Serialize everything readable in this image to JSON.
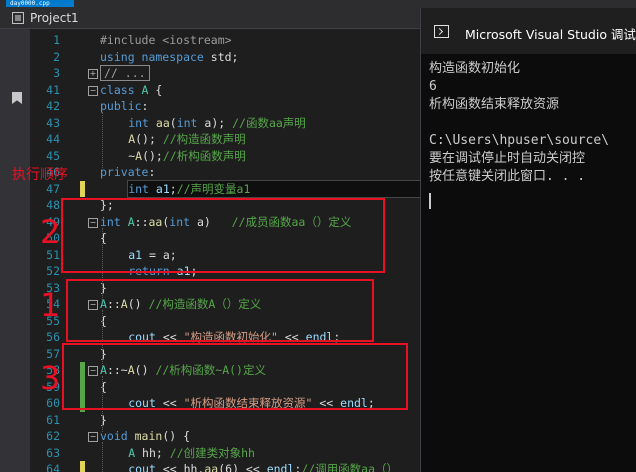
{
  "window": {
    "tab_fragment": "day0000.cpp",
    "project_label": "Project1"
  },
  "editor": {
    "lines": [
      {
        "n": "1",
        "tokens": [
          {
            "t": "pp",
            "v": "#include <iostream>"
          }
        ]
      },
      {
        "n": "2",
        "tokens": [
          {
            "t": "kw",
            "v": "using namespace "
          },
          {
            "t": "pl",
            "v": "std;"
          }
        ]
      },
      {
        "n": "3",
        "fold": "+",
        "collapsed": "// ..."
      },
      {
        "n": "41",
        "fold": "-",
        "tokens": [
          {
            "t": "kw",
            "v": "class "
          },
          {
            "t": "ty",
            "v": "A"
          },
          {
            "t": "pl",
            "v": " {"
          }
        ]
      },
      {
        "n": "42",
        "tokens": [
          {
            "t": "kw",
            "v": "public"
          },
          {
            "t": "pl",
            "v": ":"
          }
        ]
      },
      {
        "n": "43",
        "indent": 2,
        "tokens": [
          {
            "t": "kw",
            "v": "int "
          },
          {
            "t": "fn",
            "v": "aa"
          },
          {
            "t": "pl",
            "v": "("
          },
          {
            "t": "kw",
            "v": "int "
          },
          {
            "t": "pl",
            "v": "a); "
          },
          {
            "t": "cm",
            "v": "//函数aa声明"
          }
        ]
      },
      {
        "n": "44",
        "indent": 2,
        "tokens": [
          {
            "t": "fn",
            "v": "A"
          },
          {
            "t": "pl",
            "v": "(); "
          },
          {
            "t": "cm",
            "v": "//构造函数声明"
          }
        ]
      },
      {
        "n": "45",
        "indent": 2,
        "tokens": [
          {
            "t": "pl",
            "v": "~"
          },
          {
            "t": "fn",
            "v": "A"
          },
          {
            "t": "pl",
            "v": "();"
          },
          {
            "t": "cm",
            "v": "//析构函数声明"
          }
        ]
      },
      {
        "n": "46",
        "tokens": [
          {
            "t": "kw",
            "v": "private"
          },
          {
            "t": "pl",
            "v": ":"
          }
        ]
      },
      {
        "n": "47",
        "indent": 2,
        "highlight": true,
        "mark": "yellow",
        "tokens": [
          {
            "t": "kw",
            "v": "int "
          },
          {
            "t": "var",
            "v": "a1"
          },
          {
            "t": "pl",
            "v": ";"
          },
          {
            "t": "cm",
            "v": "//声明变量a1"
          }
        ]
      },
      {
        "n": "48",
        "tokens": [
          {
            "t": "pl",
            "v": "};"
          }
        ]
      },
      {
        "n": "49",
        "fold": "-",
        "tokens": [
          {
            "t": "kw",
            "v": "int "
          },
          {
            "t": "ty",
            "v": "A"
          },
          {
            "t": "pl",
            "v": "::"
          },
          {
            "t": "fn",
            "v": "aa"
          },
          {
            "t": "pl",
            "v": "("
          },
          {
            "t": "kw",
            "v": "int "
          },
          {
            "t": "pl",
            "v": "a)   "
          },
          {
            "t": "cm",
            "v": "//成员函数aa（）定义"
          }
        ]
      },
      {
        "n": "50",
        "tokens": [
          {
            "t": "pl",
            "v": "{"
          }
        ]
      },
      {
        "n": "51",
        "indent": 2,
        "tokens": [
          {
            "t": "var",
            "v": "a1"
          },
          {
            "t": "pl",
            "v": " = a;"
          }
        ]
      },
      {
        "n": "52",
        "indent": 2,
        "tokens": [
          {
            "t": "kw",
            "v": "return "
          },
          {
            "t": "var",
            "v": "a1"
          },
          {
            "t": "pl",
            "v": ";"
          }
        ]
      },
      {
        "n": "53",
        "tokens": [
          {
            "t": "pl",
            "v": "}"
          }
        ]
      },
      {
        "n": "54",
        "fold": "-",
        "tokens": [
          {
            "t": "ty",
            "v": "A"
          },
          {
            "t": "pl",
            "v": "::"
          },
          {
            "t": "fn",
            "v": "A"
          },
          {
            "t": "pl",
            "v": "() "
          },
          {
            "t": "cm",
            "v": "//构造函数A（）定义"
          }
        ]
      },
      {
        "n": "55",
        "tokens": [
          {
            "t": "pl",
            "v": "{"
          }
        ]
      },
      {
        "n": "56",
        "indent": 2,
        "tokens": [
          {
            "t": "var",
            "v": "cout"
          },
          {
            "t": "pl",
            "v": " << "
          },
          {
            "t": "str",
            "v": "\"构造函数初始化\""
          },
          {
            "t": "pl",
            "v": " << "
          },
          {
            "t": "var",
            "v": "endl"
          },
          {
            "t": "pl",
            "v": ";"
          }
        ]
      },
      {
        "n": "57",
        "tokens": [
          {
            "t": "pl",
            "v": "}"
          }
        ]
      },
      {
        "n": "58",
        "fold": "-",
        "mark": "green",
        "tokens": [
          {
            "t": "ty",
            "v": "A"
          },
          {
            "t": "pl",
            "v": "::~"
          },
          {
            "t": "fn",
            "v": "A"
          },
          {
            "t": "pl",
            "v": "() "
          },
          {
            "t": "cm",
            "v": "//析构函数~A()定义"
          }
        ]
      },
      {
        "n": "59",
        "mark": "green",
        "tokens": [
          {
            "t": "pl",
            "v": "{"
          }
        ]
      },
      {
        "n": "60",
        "indent": 2,
        "mark": "green",
        "tokens": [
          {
            "t": "var",
            "v": "cout"
          },
          {
            "t": "pl",
            "v": " << "
          },
          {
            "t": "str",
            "v": "\"析构函数结束释放资源\""
          },
          {
            "t": "pl",
            "v": " << "
          },
          {
            "t": "var",
            "v": "endl"
          },
          {
            "t": "pl",
            "v": ";"
          }
        ]
      },
      {
        "n": "61",
        "tokens": [
          {
            "t": "pl",
            "v": "}"
          }
        ]
      },
      {
        "n": "62",
        "fold": "-",
        "tokens": [
          {
            "t": "kw",
            "v": "void "
          },
          {
            "t": "fn",
            "v": "main"
          },
          {
            "t": "pl",
            "v": "() {"
          }
        ]
      },
      {
        "n": "63",
        "indent": 2,
        "tokens": [
          {
            "t": "ty",
            "v": "A"
          },
          {
            "t": "pl",
            "v": " hh; "
          },
          {
            "t": "cm",
            "v": "//创建类对象hh"
          }
        ]
      },
      {
        "n": "64",
        "indent": 2,
        "mark": "yellow",
        "tokens": [
          {
            "t": "var",
            "v": "cout"
          },
          {
            "t": "pl",
            "v": " << hh."
          },
          {
            "t": "fn",
            "v": "aa"
          },
          {
            "t": "pl",
            "v": "(6) << "
          },
          {
            "t": "var",
            "v": "endl"
          },
          {
            "t": "pl",
            "v": ";"
          },
          {
            "t": "cm",
            "v": "//调用函数aa（）"
          }
        ]
      },
      {
        "n": "65",
        "tokens": [
          {
            "t": "pl",
            "v": "}"
          }
        ]
      }
    ]
  },
  "annotations": {
    "order_label": "执行顺序",
    "num1": "1",
    "num2": "2",
    "num3": "3"
  },
  "console": {
    "title": "Microsoft Visual Studio 调试控",
    "lines": [
      "构造函数初始化",
      "6",
      "析构函数结束释放资源",
      "",
      "C:\\Users\\hpuser\\source\\",
      "要在调试停止时自动关闭控",
      "按任意键关闭此窗口. . ."
    ]
  },
  "colors": {
    "annotation_red": "#e81123",
    "keyword": "#569cd6",
    "comment": "#57a64a",
    "string": "#d69d85",
    "line_number": "#2b91af"
  }
}
